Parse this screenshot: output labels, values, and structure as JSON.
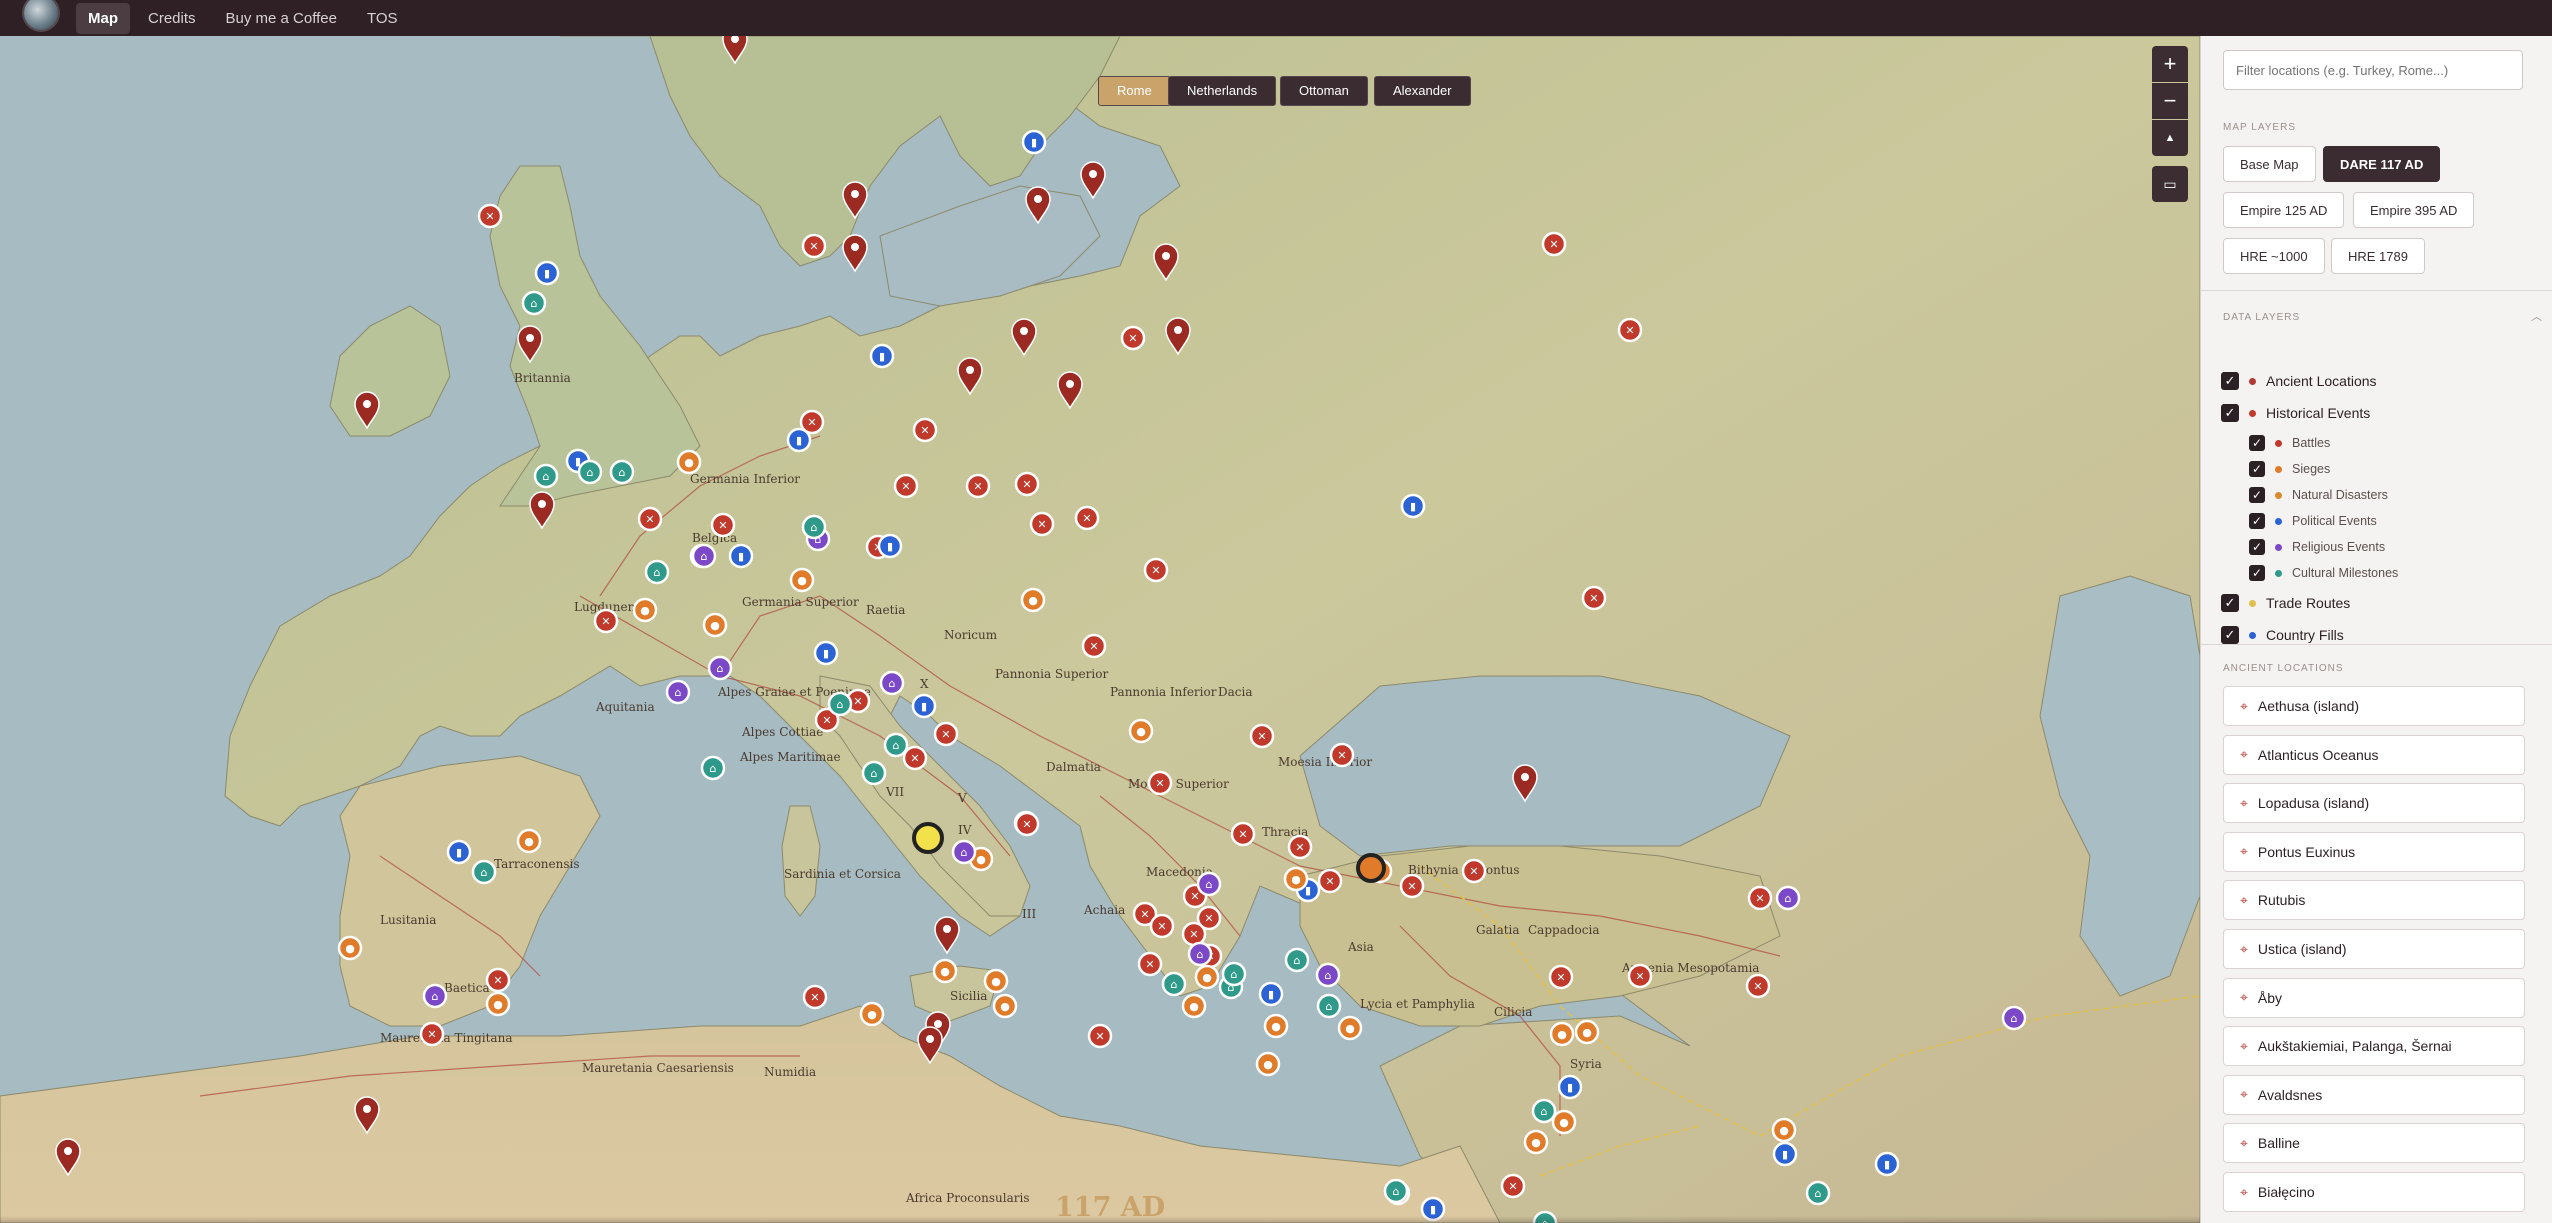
{
  "nav": {
    "items": [
      {
        "label": "Map",
        "active": true
      },
      {
        "label": "Credits",
        "active": false
      },
      {
        "label": "Buy me a Coffee",
        "active": false
      },
      {
        "label": "TOS",
        "active": false
      }
    ]
  },
  "map_toggles": [
    {
      "label": "Rome",
      "active": true
    },
    {
      "label": "Netherlands",
      "active": false
    },
    {
      "label": "Ottoman",
      "active": false
    },
    {
      "label": "Alexander",
      "active": false
    }
  ],
  "zoom": {
    "in": "+",
    "out": "−",
    "compass": "▲"
  },
  "era": "117 AD",
  "sidebar": {
    "filter_placeholder": "Filter locations (e.g. Turkey, Rome...)",
    "map_layers_heading": "MAP LAYERS",
    "map_layers": [
      {
        "label": "Base Map",
        "active": false
      },
      {
        "label": "DARE 117 AD",
        "active": true
      },
      {
        "label": "Empire 125 AD",
        "active": false
      },
      {
        "label": "Empire 395 AD",
        "active": false
      },
      {
        "label": "HRE ~1000",
        "active": false
      },
      {
        "label": "HRE 1789",
        "active": false
      }
    ],
    "data_layers_heading": "DATA LAYERS",
    "data_layers": [
      {
        "label": "Ancient Locations",
        "color": "#b23a34",
        "checked": true,
        "sub": false
      },
      {
        "label": "Historical Events",
        "color": "#c0392b",
        "checked": true,
        "sub": false
      },
      {
        "label": "Battles",
        "color": "#c0392b",
        "checked": true,
        "sub": true
      },
      {
        "label": "Sieges",
        "color": "#e07b2a",
        "checked": true,
        "sub": true
      },
      {
        "label": "Natural Disasters",
        "color": "#d98b2b",
        "checked": true,
        "sub": true
      },
      {
        "label": "Political Events",
        "color": "#2c63d4",
        "checked": true,
        "sub": true
      },
      {
        "label": "Religious Events",
        "color": "#7b48c8",
        "checked": true,
        "sub": true
      },
      {
        "label": "Cultural Milestones",
        "color": "#2f9a8a",
        "checked": true,
        "sub": true
      },
      {
        "label": "Trade Routes",
        "color": "#e0c04a",
        "checked": true,
        "sub": false
      },
      {
        "label": "Country Fills",
        "color": "#2c63d4",
        "checked": true,
        "sub": false
      }
    ],
    "ancient_locations_heading": "ANCIENT LOCATIONS",
    "ancient_locations": [
      "Aethusa (island)",
      "Atlanticus Oceanus",
      "Lopadusa (island)",
      "Pontus Euxinus",
      "Rutubis",
      "Ustica (island)",
      "Åby",
      "Aukštakiemiai, Palanga, Šernai",
      "Avaldsnes",
      "Balline",
      "Białęcino"
    ]
  },
  "map_labels": [
    "Britannia",
    "Germania Inferior",
    "Belgica",
    "Germania Superior",
    "Raetia",
    "Noricum",
    "Lugdunensis",
    "Aquitania",
    "Alpes Graiae et Poeninae",
    "Alpes Cottiae",
    "Alpes Maritimae",
    "Pannonia Superior",
    "Pannonia Inferior",
    "Dacia",
    "Moesia Inferior",
    "Moesia Superior",
    "Dalmatia",
    "Thracia",
    "Macedonia",
    "Achaia",
    "Asia",
    "Bithynia et Pontus",
    "Galatia",
    "Cappadocia",
    "Armenia Mesopotamia",
    "Lycia et Pamphylia",
    "Cilicia",
    "Syria",
    "Sardinia et Corsica",
    "Sicilia",
    "Lusitania",
    "Tarraconensis",
    "Baetica",
    "Mauretania Tingitana",
    "Mauretania Caesariensis",
    "Numidia",
    "Africa Proconsularis",
    "III",
    "IV",
    "VII",
    "X",
    "V"
  ],
  "colors": {
    "battle": "#c0392b",
    "siege": "#e07b2a",
    "political": "#2c63d4",
    "religious": "#7b48c8",
    "cultural": "#2f9a8a",
    "location": "#9b2a22",
    "sea": "#b2c4ca",
    "land": "#c9c59a",
    "topbar": "#2e2025"
  }
}
